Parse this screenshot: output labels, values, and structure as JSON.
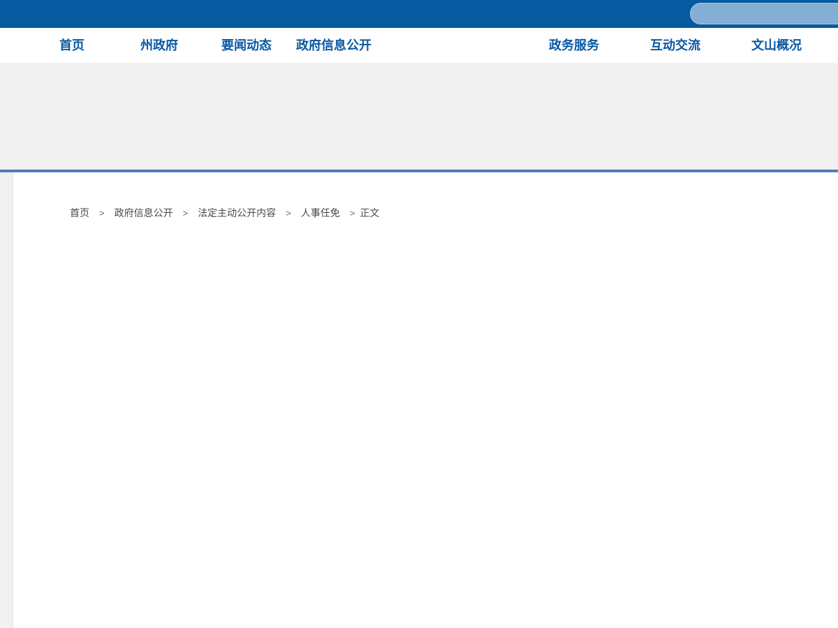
{
  "topbar": {
    "search": {
      "value": ""
    }
  },
  "nav": {
    "items": [
      {
        "label": "首页"
      },
      {
        "label": "州政府"
      },
      {
        "label": "要闻动态"
      },
      {
        "label": "政府信息公开"
      },
      {
        "label": "政务服务"
      },
      {
        "label": "互动交流"
      },
      {
        "label": "文山概况"
      }
    ]
  },
  "breadcrumb": {
    "separator": ">",
    "items": [
      "首页",
      "政府信息公开",
      "法定主动公开内容",
      "人事任免",
      "正文"
    ]
  },
  "colors": {
    "topbar_blue": "#065a9f",
    "nav_link_blue": "#0a58a3",
    "search_pill_blue": "#85aed4",
    "banner_gray": "#f1f1f2",
    "divider_blue": "#4f7dbb"
  }
}
